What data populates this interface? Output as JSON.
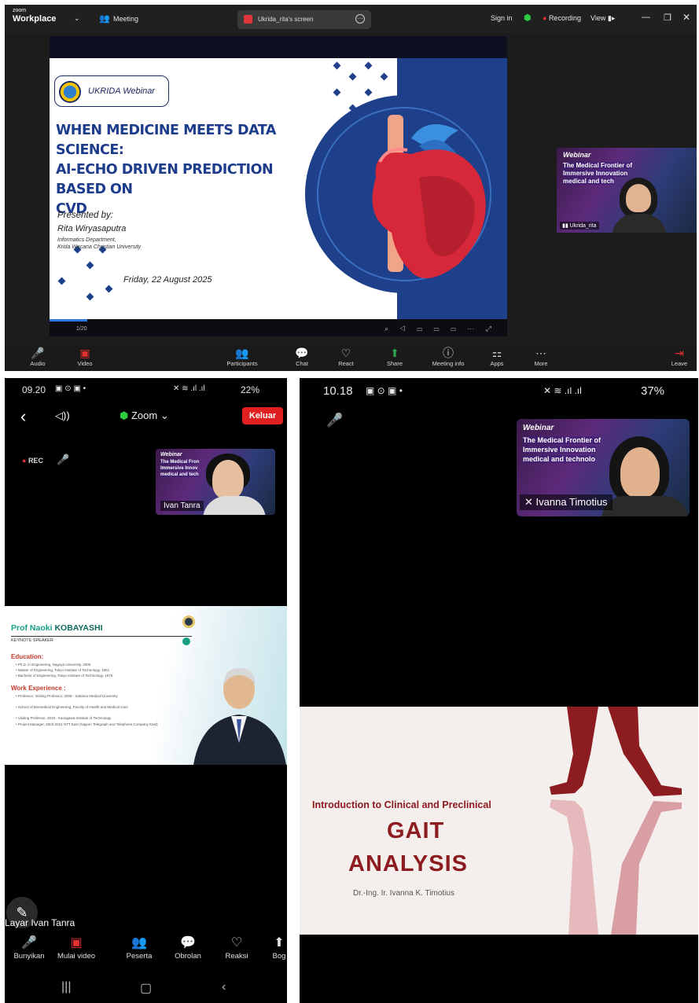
{
  "desktop": {
    "app_logo_small": "zoom",
    "app_logo_big": "Workplace",
    "meeting_label": "Meeting",
    "tab_label": "Ukrida_rita's screen",
    "sign_in": "Sign in",
    "recording": "Recording",
    "view": "View",
    "slide": {
      "badge": "UKRIDA Webinar",
      "title_line1": "WHEN MEDICINE MEETS DATA SCIENCE:",
      "title_line2": "AI-ECHO DRIVEN PREDICTION BASED ON",
      "title_line3": "CVD",
      "presented_by": "Presented by:",
      "presenter": "Rita Wiryasaputra",
      "dept1": "Informatics Department,",
      "dept2": "Krida Wacana Christian University",
      "date": "Friday, 22 August 2025",
      "page": "1/20"
    },
    "thumb": {
      "webinar": "Webinar",
      "line1": "The Medical Frontier of",
      "line2": "Immersive Innovation",
      "line3": "medical and tech",
      "name": "Ukrida_rita"
    },
    "toolbar": [
      {
        "icon": "mic-muted-icon",
        "glyph": "🎤",
        "label": "Audio"
      },
      {
        "icon": "video-off-icon",
        "glyph": "▣",
        "label": "Video"
      },
      {
        "icon": "participants-icon",
        "glyph": "👥",
        "label": "Participants"
      },
      {
        "icon": "chat-icon",
        "glyph": "💬",
        "label": "Chat"
      },
      {
        "icon": "react-icon",
        "glyph": "♡",
        "label": "React"
      },
      {
        "icon": "share-icon",
        "glyph": "⬆",
        "label": "Share"
      },
      {
        "icon": "info-icon",
        "glyph": "ⓘ",
        "label": "Meeting info"
      },
      {
        "icon": "apps-icon",
        "glyph": "⚏",
        "label": "Apps"
      },
      {
        "icon": "more-icon",
        "glyph": "⋯",
        "label": "More"
      },
      {
        "icon": "leave-icon",
        "glyph": "⇥",
        "label": "Leave"
      }
    ],
    "colors": {
      "accent_blue": "#1e3f8a",
      "recording_red": "#e0353a",
      "share_green": "#2ea44f"
    }
  },
  "phone1": {
    "time": "09.20",
    "battery": "22%",
    "app": "Zoom",
    "leave": "Keluar",
    "rec": "REC",
    "thumb": {
      "webinar": "Webinar",
      "line1": "The Medical Fron",
      "line2": "Immersive Innov",
      "line3": "medical and tech",
      "name": "Ivan Tanra"
    },
    "slide": {
      "name_first": "Prof Naoki ",
      "name_last": "KOBAYASHI",
      "role": "KEYNOTE SPEAKER",
      "education_head": "Education:",
      "education": [
        "• Ph.D. in Engineering, Nagoya University, 2000",
        "• Master of Engineering, Tokyo Institute of Technology, 1981",
        "• Bachelor of Engineering, Tokyo Institute of Technology, 1979"
      ],
      "work_head": "Work Experience :",
      "work": [
        "• Professor, Visiting Professor, 2009 - Saitama Medical University",
        "• School of Biomedical Engineering, Faculty of Health and Medical Care",
        "• Visiting Professor, 2019 - Kanagawa Institute of Technology",
        "• Project Manager, 2003-2021 NTT East (Nippon Telegraph and Telephone Company East)"
      ]
    },
    "screen_owner": "Layar Ivan Tanra",
    "toolbar": [
      {
        "icon": "mic-muted-icon",
        "glyph": "🎤",
        "label": "Bunyikan"
      },
      {
        "icon": "video-off-icon",
        "glyph": "▣",
        "label": "Mulai video"
      },
      {
        "icon": "participants-icon",
        "glyph": "👥",
        "label": "Peserta"
      },
      {
        "icon": "chat-icon",
        "glyph": "💬",
        "label": "Obrolan"
      },
      {
        "icon": "react-icon",
        "glyph": "♡",
        "label": "Reaksi"
      },
      {
        "icon": "share-icon",
        "glyph": "⬆",
        "label": "Bog"
      }
    ]
  },
  "phone2": {
    "time": "10.18",
    "battery": "37%",
    "thumb": {
      "webinar": "Webinar",
      "line1": "The Medical Frontier of",
      "line2": "Immersive Innovation",
      "line3": "medical and technolo",
      "name": "Ivanna Timotius"
    },
    "slide": {
      "intro": "Introduction to Clinical and Preclinical",
      "title1": "GAIT",
      "title2": "ANALYSIS",
      "author": "Dr.-Ing. Ir. Ivanna K. Timotius"
    }
  }
}
